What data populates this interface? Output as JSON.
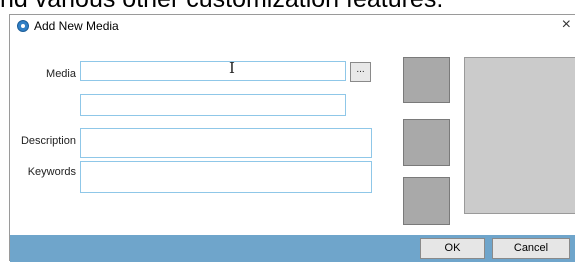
{
  "background_text": "nd various other customization features.",
  "window": {
    "title": "Add New Media",
    "close_glyph": "×"
  },
  "form": {
    "media_label": "Media",
    "browse_label": "...",
    "description_label": "Description",
    "keywords_label": "Keywords",
    "media_value": "",
    "second_value": "",
    "description_value": "",
    "keywords_value": ""
  },
  "buttons": {
    "ok": "OK",
    "cancel": "Cancel"
  },
  "colors": {
    "footer": "#6fa5cb",
    "field_border": "#8fc7e8",
    "thumb": "#a9a9a9",
    "preview": "#cbcbcb"
  },
  "icons": {
    "app": "app-icon",
    "text_cursor": "i-beam-cursor",
    "close": "close-icon"
  }
}
